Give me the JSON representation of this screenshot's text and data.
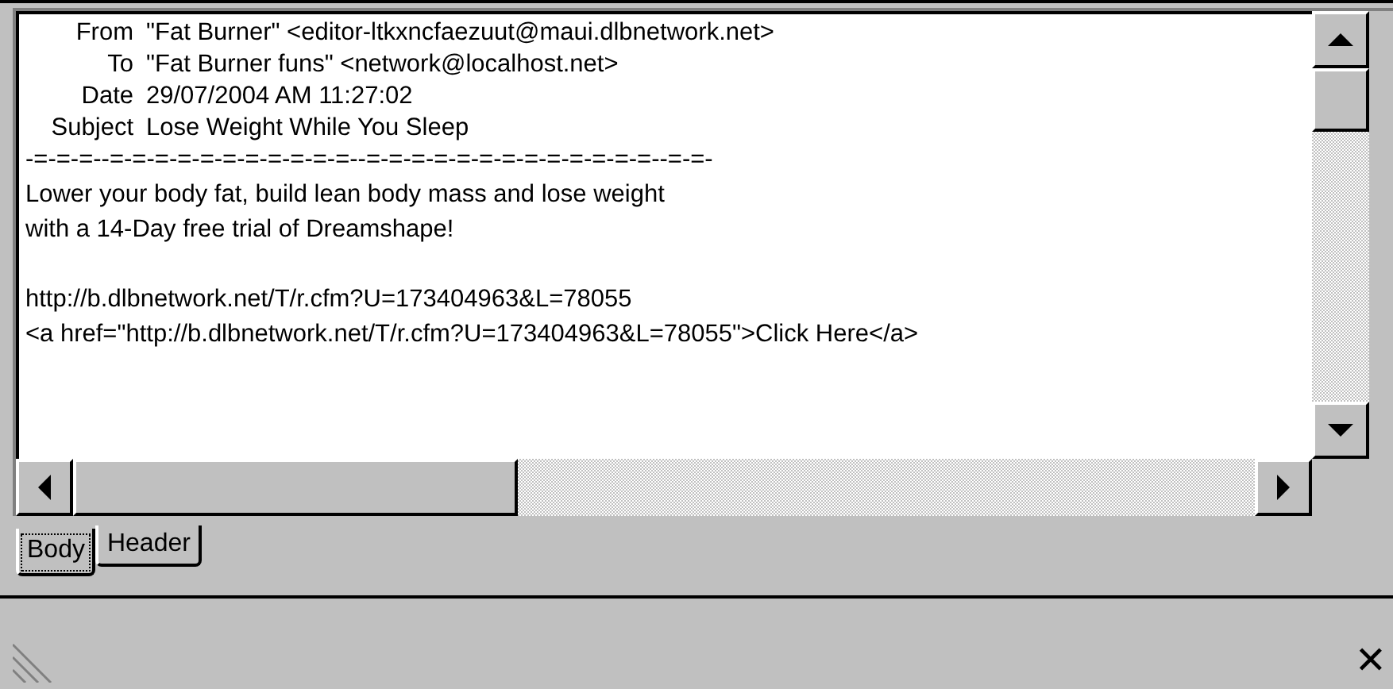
{
  "headers": [
    {
      "label": "From",
      "value": "\"Fat Burner\" <editor-ltkxncfaezuut@maui.dlbnetwork.net>"
    },
    {
      "label": "To",
      "value": "\"Fat Burner funs\" <network@localhost.net>"
    },
    {
      "label": "Date",
      "value": "29/07/2004 AM 11:27:02"
    },
    {
      "label": "Subject",
      "value": "Lose Weight While You Sleep"
    }
  ],
  "divider": "-=-=-=--=-=-=-=-=-=-=-=-=-=-=--=-=-=-=-=-=-=-=-=-=-=-=-=--=-=-",
  "paragraphs": [
    [
      "Lower your body fat, build lean body mass and lose weight",
      "with a 14-Day free trial of Dreamshape!"
    ],
    [
      "http://b.dlbnetwork.net/T/r.cfm?U=173404963&L=78055",
      "<a href=\"http://b.dlbnetwork.net/T/r.cfm?U=173404963&L=78055\">Click Here</a>"
    ]
  ],
  "tabs": [
    {
      "label": "Body",
      "selected": true
    },
    {
      "label": "Header",
      "selected": false
    }
  ],
  "close_button": "✕"
}
